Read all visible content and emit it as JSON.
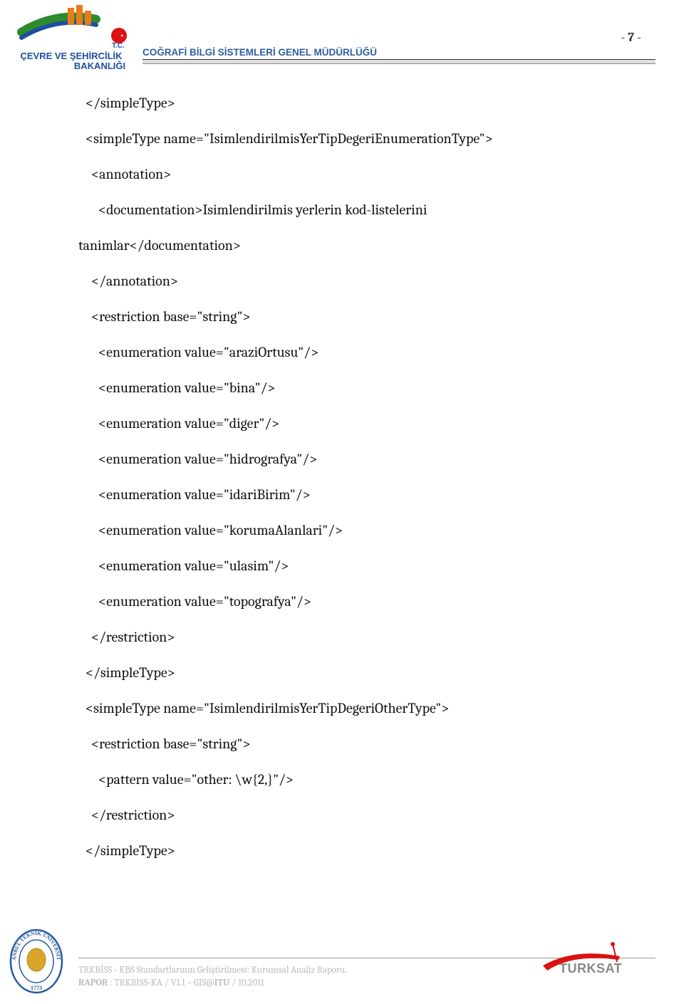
{
  "pageNumber": "7",
  "headerTitle": "COĞRAFİ BİLGİ SİSTEMLERİ GENEL MÜDÜRLÜĞÜ",
  "ministryLogo": {
    "tc": "T.C.",
    "line1": "ÇEVRE VE ŞEHİRCİLİK",
    "line2": "BAKANLIĞI"
  },
  "content": {
    "lines": [
      {
        "cls": "ind1",
        "text": "</simpleType>"
      },
      {
        "cls": "ind1",
        "text": "<simpleType name=\"IsimlendirilmisYerTipDegeriEnumerationType\">"
      },
      {
        "cls": "ind2",
        "text": "<annotation>"
      },
      {
        "cls": "ind3",
        "text": "<documentation>Isimlendirilmis yerlerin kod-listelerini"
      },
      {
        "cls": "",
        "text": "tanimlar</documentation>"
      },
      {
        "cls": "ind2",
        "text": "</annotation>"
      },
      {
        "cls": "ind2",
        "text": "<restriction base=\"string\">"
      },
      {
        "cls": "ind3",
        "text": "<enumeration value=\"araziOrtusu\"/>"
      },
      {
        "cls": "ind3",
        "text": "<enumeration value=\"bina\"/>"
      },
      {
        "cls": "ind3",
        "text": "<enumeration value=\"diger\"/>"
      },
      {
        "cls": "ind3",
        "text": "<enumeration value=\"hidrografya\"/>"
      },
      {
        "cls": "ind3",
        "text": "<enumeration value=\"idariBirim\"/>"
      },
      {
        "cls": "ind3",
        "text": "<enumeration value=\"korumaAlanlari\"/>"
      },
      {
        "cls": "ind3",
        "text": "<enumeration value=\"ulasim\"/>"
      },
      {
        "cls": "ind3",
        "text": "<enumeration value=\"topografya\"/>"
      },
      {
        "cls": "ind2",
        "text": "</restriction>"
      },
      {
        "cls": "ind1",
        "text": "</simpleType>"
      },
      {
        "cls": "ind1",
        "text": "<simpleType name=\"IsimlendirilmisYerTipDegeriOtherType\">"
      },
      {
        "cls": "ind2",
        "text": "<restriction base=\"string\">"
      },
      {
        "cls": "ind3",
        "text": "<pattern value=\"other: \\w{2,}\"/>"
      },
      {
        "cls": "ind2",
        "text": "</restriction>"
      },
      {
        "cls": "ind1",
        "text": "</simpleType>"
      }
    ]
  },
  "footer": {
    "line1": "TRKBİSS - KBS Standartlarının Geliştirilmesi: Kurumsal Analiz Raporu.",
    "raporLabel": "RAPOR",
    "line2rest": " : TRKBİSS-KA / V1.1 – GIS@",
    "ituStrong": "ITU",
    "line2tail": " / 10.2011"
  },
  "ituLogo": {
    "top": "İSTANBUL TEKNİK ÜNİVERSİTESİ",
    "year": "1773"
  },
  "turksatLogo": "TURKSAT"
}
